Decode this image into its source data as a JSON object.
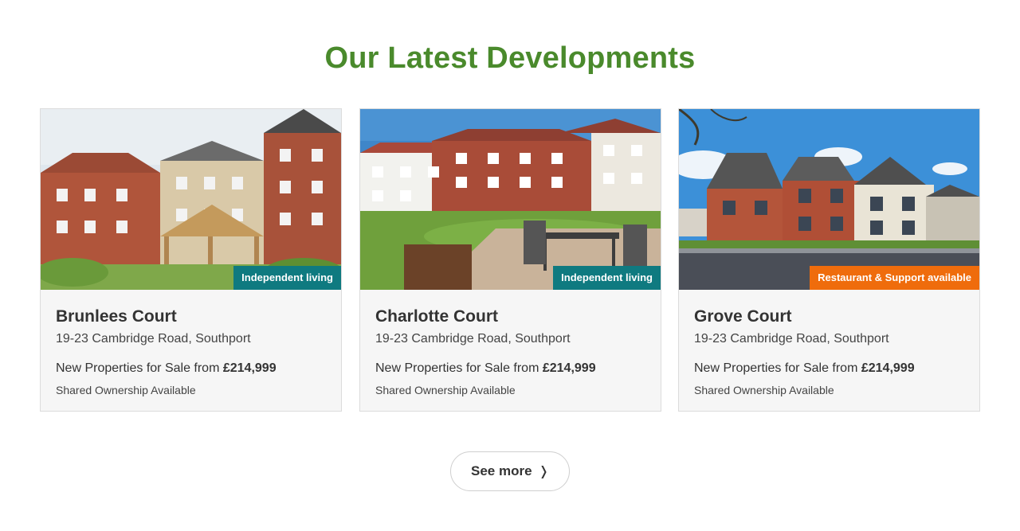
{
  "section": {
    "title": "Our Latest Developments"
  },
  "colors": {
    "title_green": "#4a8a2c",
    "badge_teal": "#0f7a80",
    "badge_orange": "#ef6c0c"
  },
  "cards": [
    {
      "title": "Brunlees Court",
      "address": "19-23 Cambridge Road, Southport",
      "price_prefix": "New Properties for Sale from",
      "price": "£214,999",
      "note": "Shared Ownership Available",
      "badge": "Independent living",
      "badge_color": "teal",
      "image": "apartment-building-with-pergola-garden"
    },
    {
      "title": "Charlotte Court",
      "address": "19-23 Cambridge Road, Southport",
      "price_prefix": "New Properties for Sale from",
      "price": "£214,999",
      "note": "Shared Ownership Available",
      "badge": "Independent living",
      "badge_color": "teal",
      "image": "apartment-building-with-patio-furniture"
    },
    {
      "title": "Grove Court",
      "address": "19-23 Cambridge Road, Southport",
      "price_prefix": "New Properties for Sale from",
      "price": "£214,999",
      "note": "Shared Ownership Available",
      "badge": "Restaurant & Support available",
      "badge_color": "orange",
      "image": "apartment-building-street-view"
    }
  ],
  "see_more": {
    "label": "See more",
    "icon": "chevron-right-icon"
  }
}
